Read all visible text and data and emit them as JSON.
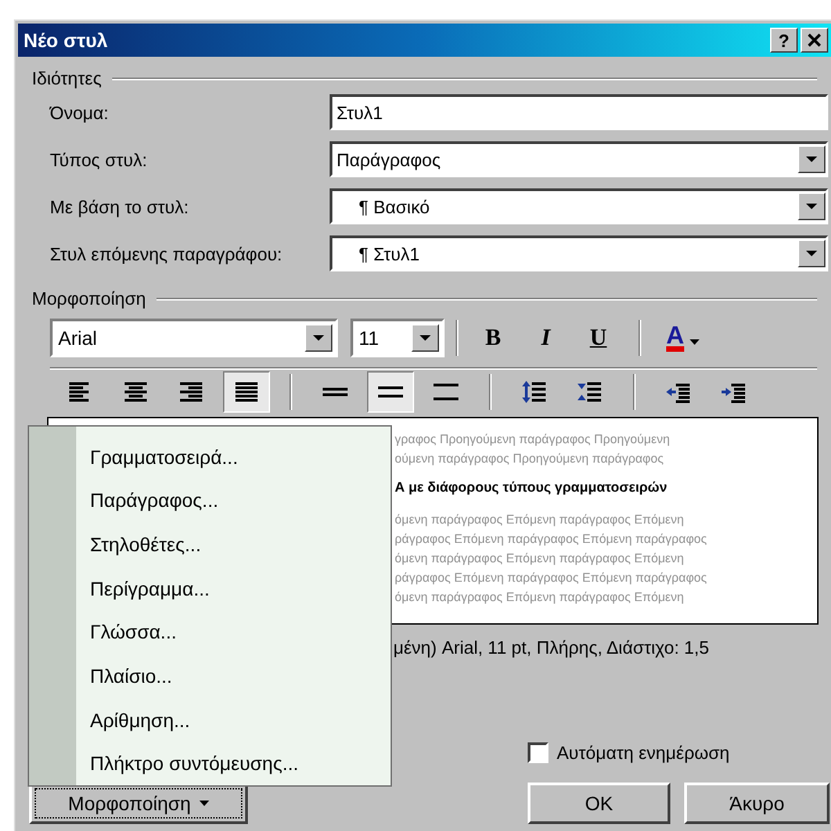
{
  "window": {
    "title": "Νέο στυλ",
    "help": "?"
  },
  "properties": {
    "label": "Ιδιότητες",
    "fields": [
      {
        "label": "Όνομα:",
        "kind": "text",
        "value": "Στυλ1"
      },
      {
        "label": "Τύπος στυλ:",
        "kind": "dropdown",
        "value": "Παράγραφος"
      },
      {
        "label": "Με βάση το στυλ:",
        "kind": "dropdown",
        "value": "¶ Βασικό"
      },
      {
        "label": "Στυλ επόμενης παραγράφου:",
        "kind": "dropdown",
        "value": "¶ Στυλ1"
      }
    ]
  },
  "formatting": {
    "label": "Μορφοποίηση",
    "font": "Arial",
    "size": "11",
    "text_buttons": [
      {
        "kind": "bold",
        "label": "B"
      },
      {
        "kind": "italic",
        "label": "I"
      },
      {
        "kind": "underline",
        "label": "U"
      }
    ],
    "font_color": {
      "label": "A",
      "color": "#e00000"
    },
    "alignment": [
      {
        "kind": "left",
        "selected": false
      },
      {
        "kind": "center",
        "selected": false
      },
      {
        "kind": "right",
        "selected": false
      },
      {
        "kind": "justify",
        "selected": true
      }
    ],
    "line_spacing": [
      {
        "kind": "single",
        "selected": false
      },
      {
        "kind": "one-half",
        "selected": true
      },
      {
        "kind": "double",
        "selected": false
      }
    ],
    "paragraph_spacing": [
      {
        "kind": "increase"
      },
      {
        "kind": "decrease"
      }
    ],
    "indent": [
      {
        "kind": "decrease"
      },
      {
        "kind": "increase"
      }
    ]
  },
  "preview": {
    "previous_lines": [
      "γραφος Προηγούμενη παράγραφος Προηγούμενη",
      "ούμενη παράγραφος Προηγούμενη παράγραφος"
    ],
    "sample": "Α με διάφορους τύπους γραμματοσειρών",
    "next_lines": [
      "όμενη παράγραφος Επόμενη παράγραφος Επόμενη",
      "ράγραφος Επόμενη παράγραφος Επόμενη παράγραφος",
      "όμενη παράγραφος Επόμενη παράγραφος Επόμενη",
      "ράγραφος Επόμενη παράγραφος Επόμενη παράγραφος",
      "όμενη παράγραφος Επόμενη παράγραφος Επόμενη"
    ]
  },
  "description": "μένη) Arial, 11 pt, Πλήρης, Διάστιχο:  1,5",
  "menu": {
    "items": [
      "Γραμματοσειρά...",
      "Παράγραφος...",
      "Στηλοθέτες...",
      "Περίγραμμα...",
      "Γλώσσα...",
      "Πλαίσιο...",
      "Αρίθμηση...",
      "Πλήκτρο συντόμευσης..."
    ]
  },
  "auto_update": {
    "label": "Αυτόματη ενημέρωση",
    "checked": false
  },
  "buttons": {
    "format": "Μορφοποίηση",
    "ok": "OK",
    "cancel": "Άκυρο"
  }
}
